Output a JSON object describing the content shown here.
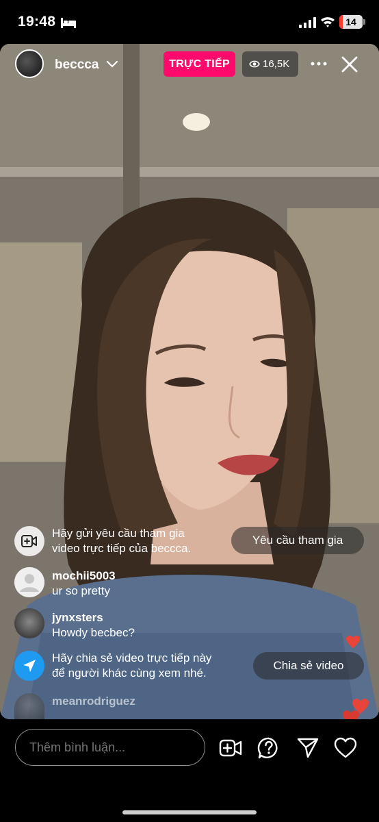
{
  "status_bar": {
    "time": "19:48",
    "battery": "14",
    "battery_level": 0.14
  },
  "header": {
    "host_name": "beccca",
    "live_label": "TRỰC TIẾP",
    "viewer_count": "16,5K"
  },
  "comments": [
    {
      "type": "system",
      "icon": "video-add-icon",
      "line1": "Hãy gửi yêu cầu tham gia",
      "line2": "video trực tiếp của beccca.",
      "action": "Yêu cầu tham gia"
    },
    {
      "type": "user",
      "user": "mochii5003",
      "text": "ur so pretty",
      "avatar": "default-avatar"
    },
    {
      "type": "user",
      "user": "jynxsters",
      "text": "Howdy becbec?",
      "avatar": "photo-avatar"
    },
    {
      "type": "system",
      "icon": "send-icon",
      "line1": "Hãy chia sẻ video trực tiếp này",
      "line2": "để người khác cùng xem nhé.",
      "action": "Chia sẻ video"
    },
    {
      "type": "user",
      "user": "meanrodriguez",
      "text": "",
      "avatar": "photo-avatar"
    }
  ],
  "bottom_bar": {
    "comment_placeholder": "Thêm bình luận...",
    "icons": [
      "add-video-icon",
      "question-icon",
      "send-icon",
      "heart-icon"
    ]
  },
  "colors": {
    "live": "#ff0a6c",
    "share_blue": "#1e9bf0",
    "heart": "#e8443a"
  }
}
